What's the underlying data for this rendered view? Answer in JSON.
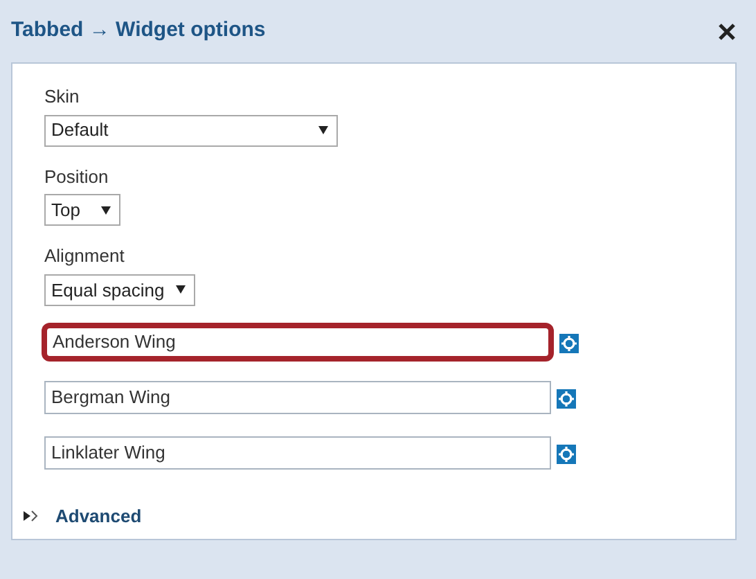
{
  "window": {
    "title": "Tabbed → Widget options"
  },
  "selects": [
    {
      "label": "Skin",
      "value": "Default"
    },
    {
      "label": "Position",
      "value": "Top"
    },
    {
      "label": "Alignment",
      "value": "Equal spacing"
    }
  ],
  "tab_fields": [
    {
      "value": "Anderson Wing",
      "focused": true
    },
    {
      "value": "Bergman Wing",
      "focused": false
    },
    {
      "value": "Linklater Wing",
      "focused": false
    }
  ],
  "advanced": {
    "label": "Advanced",
    "expanded": false
  }
}
